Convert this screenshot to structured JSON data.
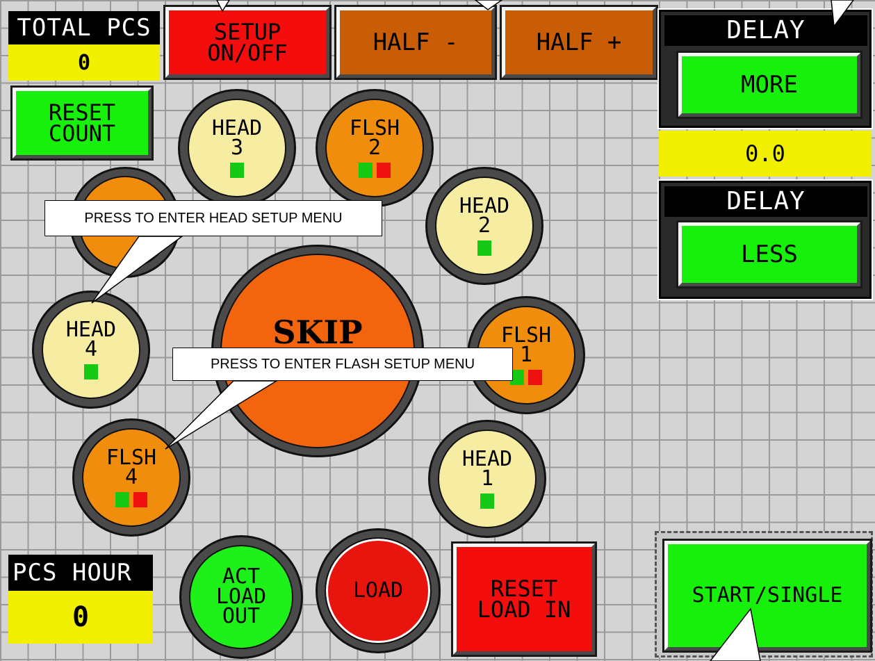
{
  "total_pcs": {
    "label": "TOTAL PCS",
    "value": "0"
  },
  "reset_count": {
    "label": "RESET\nCOUNT"
  },
  "top_buttons": {
    "setup": "SETUP\nON/OFF",
    "half_minus": "HALF -",
    "half_plus": "HALF +"
  },
  "delay": {
    "more_header": "DELAY",
    "more_label": "MORE",
    "value": "0.0",
    "less_header": "DELAY",
    "less_label": "LESS"
  },
  "stations": {
    "head3": "HEAD\n3",
    "flsh2": "FLSH\n2",
    "head2": "HEAD\n2",
    "head4": "HEAD\n4",
    "flsh1": "FLSH\n1",
    "flsh4": "FLSH\n4",
    "head1": "HEAD\n1",
    "skip": "SKIP"
  },
  "bottom": {
    "pcs_hour_label": "PCS HOUR",
    "pcs_hour_value": "0",
    "act_load_out": "ACT\nLOAD\nOUT",
    "load": "LOAD",
    "reset_load_in": "RESET\nLOAD IN",
    "start_single": "START/SINGLE"
  },
  "callouts": {
    "head_setup": "PRESS TO ENTER HEAD SETUP MENU",
    "flash_setup": "PRESS TO ENTER FLASH SETUP MENU"
  },
  "colors": {
    "green": "#17f00a",
    "red": "#f40d0d",
    "brown": "#c95d06",
    "yellow": "#f0f000",
    "cream": "#f6eca2",
    "orange": "#f18d0c"
  }
}
